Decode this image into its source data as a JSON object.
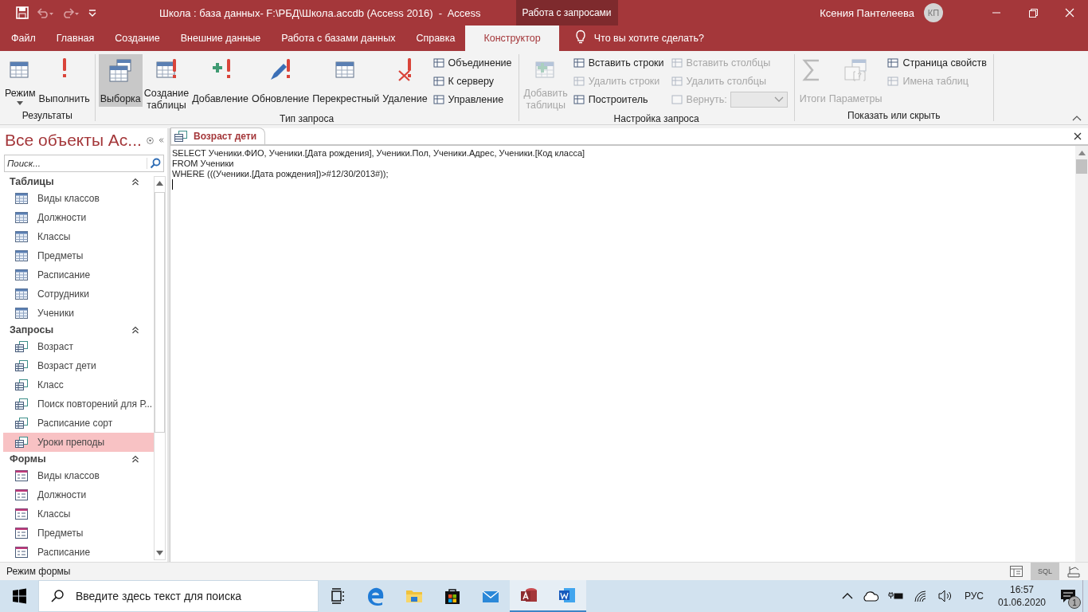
{
  "title_bar": {
    "title": "Школа : база данных- F:\\РБД\\Школа.accdb (Access 2016)  -  Access",
    "context_tab": "Работа с запросами",
    "user": "Ксения Пантелеева",
    "avatar": "КП"
  },
  "ribbon_tabs": [
    {
      "label": "Файл",
      "selected": false
    },
    {
      "label": "Главная",
      "selected": false
    },
    {
      "label": "Создание",
      "selected": false
    },
    {
      "label": "Внешние данные",
      "selected": false
    },
    {
      "label": "Работа с базами данных",
      "selected": false
    },
    {
      "label": "Справка",
      "selected": false
    },
    {
      "label": "Конструктор",
      "selected": true
    }
  ],
  "tell_me": "Что вы хотите сделать?",
  "ribbon_groups": [
    {
      "label": "Результаты",
      "controls": [
        {
          "kind": "large",
          "label": "Режим",
          "disabled": false,
          "selected": false,
          "dropdown": true
        },
        {
          "kind": "large",
          "label": "Выполнить",
          "disabled": false,
          "selected": false,
          "dropdown": false
        }
      ]
    },
    {
      "label": "Тип запроса",
      "controls": [
        {
          "kind": "large",
          "label": "Выборка",
          "disabled": false,
          "selected": true,
          "dropdown": false
        },
        {
          "kind": "large",
          "label": "Создание таблицы",
          "disabled": false,
          "selected": false,
          "dropdown": false
        },
        {
          "kind": "large",
          "label": "Добавление",
          "disabled": false,
          "selected": false,
          "dropdown": false
        },
        {
          "kind": "large",
          "label": "Обновление",
          "disabled": false,
          "selected": false,
          "dropdown": false
        },
        {
          "kind": "large",
          "label": "Перекрестный",
          "disabled": false,
          "selected": false,
          "dropdown": false
        },
        {
          "kind": "large",
          "label": "Удаление",
          "disabled": false,
          "selected": false,
          "dropdown": false
        },
        {
          "kind": "stack",
          "items": [
            {
              "kind": "small",
              "label": "Объединение",
              "disabled": false
            },
            {
              "kind": "small",
              "label": "К серверу",
              "disabled": false
            },
            {
              "kind": "small",
              "label": "Управление",
              "disabled": false
            }
          ]
        }
      ]
    },
    {
      "label": "Настройка запроса",
      "controls": [
        {
          "kind": "large",
          "label": "Добавить таблицы",
          "disabled": true,
          "selected": false,
          "dropdown": false
        },
        {
          "kind": "stack",
          "items": [
            {
              "kind": "small",
              "label": "Вставить строки",
              "disabled": false
            },
            {
              "kind": "small",
              "label": "Удалить строки",
              "disabled": true
            },
            {
              "kind": "small",
              "label": "Построитель",
              "disabled": false
            }
          ]
        },
        {
          "kind": "stack",
          "items": [
            {
              "kind": "small",
              "label": "Вставить столбцы",
              "disabled": true
            },
            {
              "kind": "small",
              "label": "Удалить столбцы",
              "disabled": true
            },
            {
              "kind": "combo",
              "label": "Вернуть:",
              "disabled": true
            }
          ]
        }
      ]
    },
    {
      "label": "Показать или скрыть",
      "controls": [
        {
          "kind": "large",
          "label": "Итоги",
          "disabled": true,
          "selected": false,
          "dropdown": false
        },
        {
          "kind": "large",
          "label": "Параметры",
          "disabled": true,
          "selected": false,
          "dropdown": false
        },
        {
          "kind": "stack",
          "items": [
            {
              "kind": "small",
              "label": "Страница свойств",
              "disabled": false
            },
            {
              "kind": "small",
              "label": "Имена таблиц",
              "disabled": true
            }
          ]
        }
      ]
    }
  ],
  "nav_pane": {
    "title": "Все объекты Ac...",
    "search": {
      "placeholder": "Поиск..."
    },
    "groups": [
      {
        "label": "Таблицы",
        "kind": "table",
        "items": [
          {
            "label": "Виды классов",
            "selected": false
          },
          {
            "label": "Должности",
            "selected": false
          },
          {
            "label": "Классы",
            "selected": false
          },
          {
            "label": "Предметы",
            "selected": false
          },
          {
            "label": "Расписание",
            "selected": false
          },
          {
            "label": "Сотрудники",
            "selected": false
          },
          {
            "label": "Ученики",
            "selected": false
          }
        ]
      },
      {
        "label": "Запросы",
        "kind": "query",
        "items": [
          {
            "label": "Возраст",
            "selected": false
          },
          {
            "label": "Возраст дети",
            "selected": false
          },
          {
            "label": "Класс",
            "selected": false
          },
          {
            "label": "Поиск повторений для Р...",
            "selected": false
          },
          {
            "label": "Расписание сорт",
            "selected": false
          },
          {
            "label": "Уроки преподы",
            "selected": true
          }
        ]
      },
      {
        "label": "Формы",
        "kind": "form",
        "items": [
          {
            "label": "Виды классов",
            "selected": false
          },
          {
            "label": "Должности",
            "selected": false
          },
          {
            "label": "Классы",
            "selected": false
          },
          {
            "label": "Предметы",
            "selected": false
          },
          {
            "label": "Расписание",
            "selected": false
          }
        ]
      }
    ]
  },
  "document": {
    "tab": "Возраст дети",
    "sql": [
      "SELECT Ученики.ФИО, Ученики.[Дата рождения], Ученики.Пол, Ученики.Адрес, Ученики.[Код класса]",
      "FROM Ученики",
      "WHERE (((Ученики.[Дата рождения])>#12/30/2013#));"
    ]
  },
  "status_bar": {
    "text": "Режим формы",
    "views": [
      {
        "kind": "datasheet",
        "selected": false
      },
      {
        "kind": "sql",
        "label": "SQL",
        "selected": true
      },
      {
        "kind": "design",
        "selected": false
      }
    ]
  },
  "taskbar": {
    "search": {
      "placeholder": "Введите здесь текст для поиска"
    },
    "apps": [
      {
        "kind": "taskview",
        "active": false
      },
      {
        "kind": "edge",
        "active": false
      },
      {
        "kind": "explorer",
        "active": false
      },
      {
        "kind": "store",
        "active": false
      },
      {
        "kind": "mail",
        "active": false
      },
      {
        "kind": "access",
        "active": true
      },
      {
        "kind": "word",
        "active": true
      }
    ],
    "language": "РУС",
    "time": "16:57",
    "date": "01.06.2020",
    "notifications": "1"
  }
}
